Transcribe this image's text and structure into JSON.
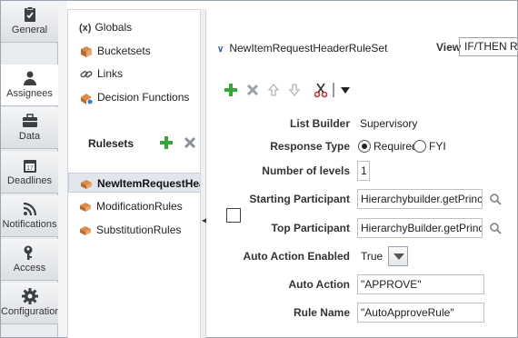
{
  "tabs": [
    {
      "label": "General",
      "icon": "clipboard-icon",
      "active": true
    },
    {
      "label": "Assignees",
      "icon": "person-icon",
      "active": false
    },
    {
      "label": "Data",
      "icon": "briefcase-icon",
      "active": false
    },
    {
      "label": "Deadlines",
      "icon": "calendar-icon",
      "active": false
    },
    {
      "label": "Notifications",
      "icon": "rss-icon",
      "active": false
    },
    {
      "label": "Access",
      "icon": "key-icon",
      "active": false
    },
    {
      "label": "Configuration",
      "icon": "gear-icon",
      "active": false
    }
  ],
  "navigator": {
    "items": [
      {
        "label": "Globals",
        "icon_text": "(x)",
        "icon": "variable-icon"
      },
      {
        "label": "Bucketsets",
        "icon": "bucketset-icon"
      },
      {
        "label": "Links",
        "icon": "link-icon"
      },
      {
        "label": "Decision Functions",
        "icon": "decision-function-icon"
      }
    ],
    "rulesets_label": "Rulesets",
    "rulesets": [
      {
        "label": "NewItemRequestHeaderRuleSet",
        "selected": true
      },
      {
        "label": "ModificationRules",
        "selected": false
      },
      {
        "label": "SubstitutionRules",
        "selected": false
      }
    ]
  },
  "main": {
    "ruleset_title": "NewItemRequestHeaderRuleSet",
    "view_label": "View",
    "view_value": "IF/THEN Rules",
    "form": {
      "list_builder": {
        "label": "List Builder",
        "value": "Supervisory"
      },
      "response_type": {
        "label": "Response Type",
        "options": [
          "Required",
          "FYI"
        ],
        "selected": "Required"
      },
      "number_of_levels": {
        "label": "Number of levels",
        "value": "1"
      },
      "starting_participant": {
        "label": "Starting Participant",
        "value": "Hierarchybuilder.getPrincipal("
      },
      "top_participant": {
        "label": "Top Participant",
        "value": "HierarchyBuilder.getPrincipal("
      },
      "auto_action_enabled": {
        "label": "Auto Action Enabled",
        "value": "True"
      },
      "auto_action": {
        "label": "Auto Action",
        "value": "\"APPROVE\""
      },
      "rule_name": {
        "label": "Rule Name",
        "value": "\"AutoApproveRule\""
      }
    }
  },
  "colors": {
    "add": "#3aa53a",
    "delete": "#8a9097",
    "cut": "#c0392b",
    "accent": "#2a5db0"
  }
}
